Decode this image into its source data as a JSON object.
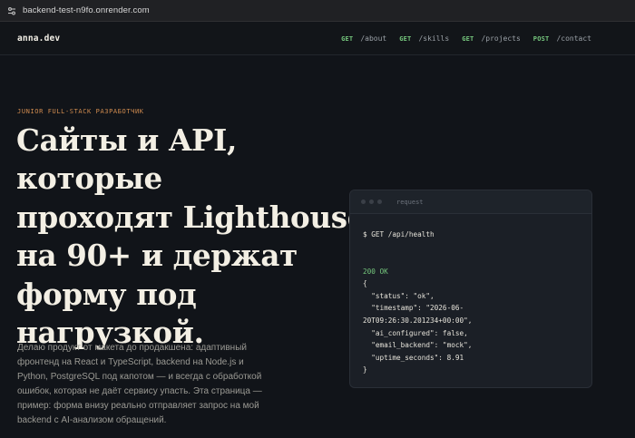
{
  "browser": {
    "url": "backend-test-n9fo.onrender.com",
    "site_icon": "site-info-icon"
  },
  "header": {
    "brand": "anna.dev",
    "nav": [
      {
        "method": "GET",
        "path": "/about"
      },
      {
        "method": "GET",
        "path": "/skills"
      },
      {
        "method": "GET",
        "path": "/projects"
      },
      {
        "method": "POST",
        "path": "/contact"
      }
    ]
  },
  "hero": {
    "eyebrow": "JUNIOR FULL-STACK РАЗРАБОТЧИК",
    "headline_lines": [
      "Сайты и API,",
      "которые",
      "проходят Lighthouse",
      "на 90+ и держат",
      "форму под",
      "нагрузкой."
    ],
    "lede": "Делаю продукт от макета до продакшена: адаптивный фронтенд на React и TypeScript, backend на Node.js и Python, PostgreSQL под капотом — и всегда с обработкой ошибок, которая не даёт сервису упасть. Эта страница — пример: форма внизу реально отправляет запрос на мой backend с AI-анализом обращений."
  },
  "terminal": {
    "title": "request",
    "command": "$ GET /api/health",
    "status": "200 OK",
    "response_lines": [
      "{",
      "  \"status\": \"ok\",",
      "  \"timestamp\": \"2026-06-",
      "20T09:26:30.201234+00:00\",",
      "  \"ai_configured\": false,",
      "  \"email_backend\": \"mock\",",
      "  \"uptime_seconds\": 8.91",
      "}"
    ]
  },
  "colors": {
    "background": "#111419",
    "accent_green": "#76c87e",
    "accent_orange": "#d08b4f",
    "card": "#1b1f26"
  }
}
